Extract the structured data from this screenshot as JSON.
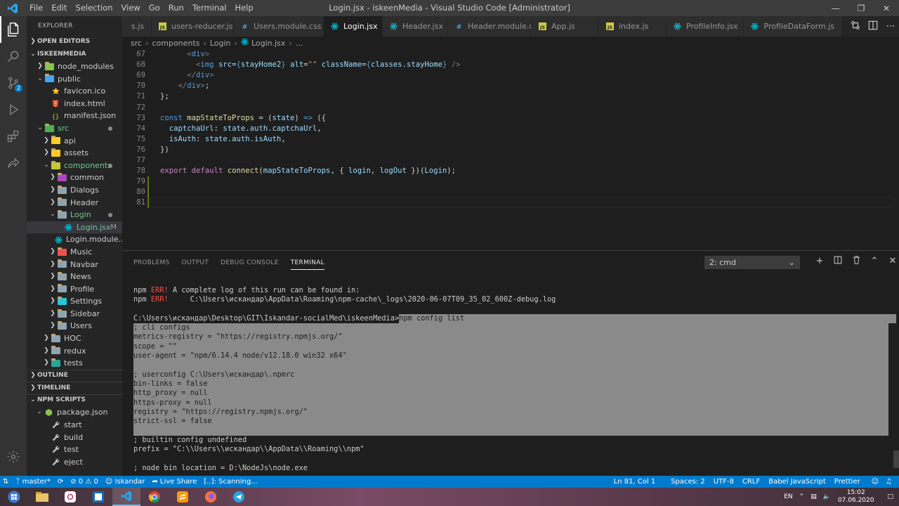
{
  "window": {
    "title": "Login.jsx - iskeenMedia - Visual Studio Code [Administrator]",
    "menu": [
      "File",
      "Edit",
      "Selection",
      "View",
      "Go",
      "Run",
      "Terminal",
      "Help"
    ]
  },
  "sidebar": {
    "title": "EXPLORER",
    "sections": {
      "open_editors": "OPEN EDITORS",
      "project": "ISKEENMEDIA",
      "outline": "OUTLINE",
      "timeline": "TIMELINE",
      "npm_scripts": "NPM SCRIPTS"
    },
    "tree": [
      {
        "label": "node_modules",
        "depth": 1,
        "kind": "folder",
        "open": false,
        "icon_color": "#8bc34a"
      },
      {
        "label": "public",
        "depth": 1,
        "kind": "folder",
        "open": true,
        "icon_color": "#42a5f5"
      },
      {
        "label": "favicon.ico",
        "depth": 2,
        "kind": "file",
        "icon": "star-icon",
        "icon_color": "#fbc02d"
      },
      {
        "label": "index.html",
        "depth": 2,
        "kind": "file",
        "icon": "html5-icon",
        "icon_color": "#e44d26"
      },
      {
        "label": "manifest.json",
        "depth": 2,
        "kind": "file",
        "icon": "json-icon",
        "icon_color": "#cbcb41"
      },
      {
        "label": "src",
        "depth": 1,
        "kind": "folder",
        "open": true,
        "icon_color": "#4caf50",
        "dot": true,
        "green": true
      },
      {
        "label": "api",
        "depth": 2,
        "kind": "folder",
        "open": false,
        "icon_color": "#ffca28"
      },
      {
        "label": "assets",
        "depth": 2,
        "kind": "folder",
        "open": false,
        "icon_color": "#ffca28"
      },
      {
        "label": "components",
        "depth": 2,
        "kind": "folder",
        "open": true,
        "icon_color": "#c0ca33",
        "dot": true,
        "green": true
      },
      {
        "label": "common",
        "depth": 3,
        "kind": "folder",
        "open": false,
        "icon_color": "#ab47bc"
      },
      {
        "label": "Dialogs",
        "depth": 3,
        "kind": "folder",
        "open": false,
        "icon_color": "#90a4ae"
      },
      {
        "label": "Header",
        "depth": 3,
        "kind": "folder",
        "open": false,
        "icon_color": "#90a4ae"
      },
      {
        "label": "Login",
        "depth": 3,
        "kind": "folder",
        "open": true,
        "icon_color": "#90a4ae",
        "dot": true,
        "green": true
      },
      {
        "label": "Login.jsx",
        "depth": 4,
        "kind": "file",
        "icon": "react-icon",
        "icon_color": "#00bcd4",
        "modified": "M",
        "selected": true,
        "green": true
      },
      {
        "label": "Login.module....",
        "depth": 4,
        "kind": "file",
        "icon": "react-icon",
        "icon_color": "#00bcd4"
      },
      {
        "label": "Music",
        "depth": 3,
        "kind": "folder",
        "open": false,
        "icon_color": "#ef5350"
      },
      {
        "label": "Navbar",
        "depth": 3,
        "kind": "folder",
        "open": false,
        "icon_color": "#90a4ae"
      },
      {
        "label": "News",
        "depth": 3,
        "kind": "folder",
        "open": false,
        "icon_color": "#90a4ae"
      },
      {
        "label": "Profile",
        "depth": 3,
        "kind": "folder",
        "open": false,
        "icon_color": "#90a4ae"
      },
      {
        "label": "Settings",
        "depth": 3,
        "kind": "folder",
        "open": false,
        "icon_color": "#26c6da"
      },
      {
        "label": "Sidebar",
        "depth": 3,
        "kind": "folder",
        "open": false,
        "icon_color": "#90a4ae"
      },
      {
        "label": "Users",
        "depth": 3,
        "kind": "folder",
        "open": false,
        "icon_color": "#90a4ae"
      },
      {
        "label": "HOC",
        "depth": 2,
        "kind": "folder",
        "open": false,
        "icon_color": "#90a4ae"
      },
      {
        "label": "redux",
        "depth": 2,
        "kind": "folder",
        "open": false,
        "icon_color": "#90a4ae"
      },
      {
        "label": "tests",
        "depth": 2,
        "kind": "folder",
        "open": false,
        "icon_color": "#26a69a"
      }
    ],
    "npm": {
      "package": "package.json",
      "scripts": [
        "start",
        "build",
        "test",
        "eject"
      ]
    }
  },
  "tabs": [
    {
      "label": "s.js",
      "icon": "js-icon",
      "icon_color": "#cbcb41"
    },
    {
      "label": "users-reducer.js",
      "icon": "js-icon",
      "icon_color": "#cbcb41"
    },
    {
      "label": "Users.module.css",
      "icon": "css-icon",
      "icon_color": "#42a5f5"
    },
    {
      "label": "Login.jsx",
      "icon": "react-icon",
      "icon_color": "#00bcd4",
      "active": true
    },
    {
      "label": "Header.jsx",
      "icon": "react-icon",
      "icon_color": "#00bcd4"
    },
    {
      "label": "Header.module.css",
      "icon": "css-icon",
      "icon_color": "#42a5f5"
    },
    {
      "label": "App.js",
      "icon": "js-icon",
      "icon_color": "#cbcb41"
    },
    {
      "label": "index.js",
      "icon": "js-icon",
      "icon_color": "#cbcb41"
    },
    {
      "label": "ProfileInfo.jsx",
      "icon": "react-icon",
      "icon_color": "#00bcd4"
    },
    {
      "label": "ProfileDataForm.js",
      "icon": "react-icon",
      "icon_color": "#00bcd4"
    }
  ],
  "breadcrumb": [
    "src",
    "components",
    "Login",
    "Login.jsx",
    "..."
  ],
  "editor": {
    "lines": [
      {
        "n": "67",
        "html": "      <span class=\"tg\">&lt;</span><span class=\"t\">div</span><span class=\"tg\">&gt;</span>"
      },
      {
        "n": "68",
        "html": "        <span class=\"tg\">&lt;</span><span class=\"t\">img</span> <span class=\"v\">src</span>=<span class=\"k\">{</span><span class=\"v\">stayHome2</span><span class=\"k\">}</span> <span class=\"v\">alt</span>=<span class=\"s\">\"\"</span> <span class=\"v\">className</span>=<span class=\"k\">{</span><span class=\"v\">classes</span>.<span class=\"v\">stayHome</span><span class=\"k\">}</span> <span class=\"tg\">/&gt;</span>"
      },
      {
        "n": "69",
        "html": "      <span class=\"tg\">&lt;/</span><span class=\"t\">div</span><span class=\"tg\">&gt;</span>"
      },
      {
        "n": "70",
        "html": "    <span class=\"tg\">&lt;/</span><span class=\"t\">div</span><span class=\"tg\">&gt;</span>;"
      },
      {
        "n": "71",
        "html": "};"
      },
      {
        "n": "72",
        "html": ""
      },
      {
        "n": "73",
        "html": "<span class=\"k\">const</span> <span class=\"f\">mapStateToProps</span> = (<span class=\"v\">state</span>) <span class=\"k\">=&gt;</span> ({"
      },
      {
        "n": "74",
        "html": "  <span class=\"v\">captchaUrl</span>: <span class=\"v\">state</span>.<span class=\"v\">auth</span>.<span class=\"v\">captchaUrl</span>,"
      },
      {
        "n": "75",
        "html": "  <span class=\"v\">isAuth</span>: <span class=\"v\">state</span>.<span class=\"v\">auth</span>.<span class=\"v\">isAuth</span>,"
      },
      {
        "n": "76",
        "html": "})"
      },
      {
        "n": "77",
        "html": ""
      },
      {
        "n": "78",
        "html": "<span class=\"ctrl\">export</span> <span class=\"ctrl\">default</span> <span class=\"f\">connect</span>(<span class=\"v\">mapStateToProps</span>, { <span class=\"v\">login</span>, <span class=\"v\">logOut</span> })(<span class=\"v\">Login</span>);"
      },
      {
        "n": "79",
        "html": ""
      },
      {
        "n": "80",
        "html": ""
      },
      {
        "n": "81",
        "html": ""
      }
    ]
  },
  "panel": {
    "tabs": [
      "PROBLEMS",
      "OUTPUT",
      "DEBUG CONSOLE",
      "TERMINAL"
    ],
    "active_tab": "TERMINAL",
    "terminal_select": "2: cmd",
    "terminal_lines": [
      {
        "pre": "npm ",
        "err": "ERR!",
        "post": " A complete log of this run can be found in:"
      },
      {
        "pre": "npm ",
        "err": "ERR!",
        "post": "     C:\\Users\\искандар\\AppData\\Roaming\\npm-cache\\_logs\\2020-06-07T09_35_02_600Z-debug.log"
      },
      {
        "pre": ""
      },
      {
        "pre": "C:\\Users\\искандар\\Desktop\\GIT\\Iskandar-socialMed\\iskeenMedia>",
        "sel": "npm config list"
      },
      {
        "sel": "; cli configs"
      },
      {
        "sel": "metrics-registry = \"https://registry.npmjs.org/\""
      },
      {
        "sel": "scope = \"\""
      },
      {
        "sel": "user-agent = \"npm/6.14.4 node/v12.18.0 win32 x64\""
      },
      {
        "sel": ""
      },
      {
        "sel": "; userconfig C:\\Users\\искандар\\.npmrc"
      },
      {
        "sel": "bin-links = false"
      },
      {
        "sel": "http_proxy = null"
      },
      {
        "sel": "https-proxy = null"
      },
      {
        "sel": "registry = \"https://registry.npmjs.org/\""
      },
      {
        "sel": "strict-ssl = false"
      },
      {
        "sel": ""
      },
      {
        "pre": "; builtin config undefined"
      },
      {
        "pre": "prefix = \"C:\\\\Users\\\\искандар\\\\AppData\\\\Roaming\\\\npm\""
      },
      {
        "pre": ""
      },
      {
        "pre": "; node bin location = D:\\NodeJs\\node.exe"
      }
    ]
  },
  "statusbar": {
    "branch": "master*",
    "errors": "0",
    "warnings": "0",
    "user": "Iskandar",
    "live_share": "Live Share",
    "scanning": "[..]: Scanning...",
    "position": "Ln 81, Col 1",
    "spaces": "Spaces: 2",
    "encoding": "UTF-8",
    "eol": "CRLF",
    "language": "Babel JavaScript",
    "formatter": "Prettier"
  },
  "taskbar": {
    "lang": "EN",
    "time": "15:02",
    "date": "07.06.2020"
  },
  "colors": {
    "accent": "#007acc",
    "editor_bg": "#1e1e1e",
    "sidebar_bg": "#252526",
    "selection": "#8a8a8a",
    "error": "#f14c4c"
  }
}
